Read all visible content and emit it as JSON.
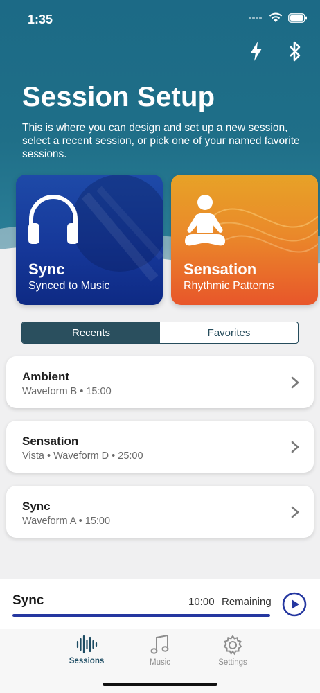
{
  "status_bar": {
    "time": "1:35"
  },
  "header": {
    "title": "Session Setup",
    "subtitle": "This is where you can design and set up a new session, select a recent session, or pick one of your named favorite sessions.",
    "icons": [
      "lightning-icon",
      "bluetooth-icon"
    ]
  },
  "cards": [
    {
      "title": "Sync",
      "subtitle": "Synced to Music",
      "icon": "headphones-icon"
    },
    {
      "title": "Sensation",
      "subtitle": "Rhythmic Patterns",
      "icon": "meditation-icon"
    }
  ],
  "segment": {
    "options": [
      "Recents",
      "Favorites"
    ],
    "selected": "Recents"
  },
  "recents": [
    {
      "title": "Ambient",
      "details": "Waveform B • 15:00"
    },
    {
      "title": "Sensation",
      "details": "Vista • Waveform D • 25:00"
    },
    {
      "title": "Sync",
      "details": "Waveform A • 15:00"
    }
  ],
  "now_playing": {
    "title": "Sync",
    "time": "10:00",
    "remaining_label": "Remaining",
    "progress": 1.0
  },
  "tabbar": {
    "items": [
      {
        "label": "Sessions",
        "icon": "waveform-icon",
        "active": true
      },
      {
        "label": "Music",
        "icon": "music-note-icon",
        "active": false
      },
      {
        "label": "Settings",
        "icon": "gear-icon",
        "active": false
      }
    ]
  },
  "colors": {
    "accent": "#2537a0",
    "header_teal": "#1c6a86",
    "segment_active": "#2a4f5e",
    "sync_card": "#16389a",
    "sensation_card": "#e8562a"
  }
}
